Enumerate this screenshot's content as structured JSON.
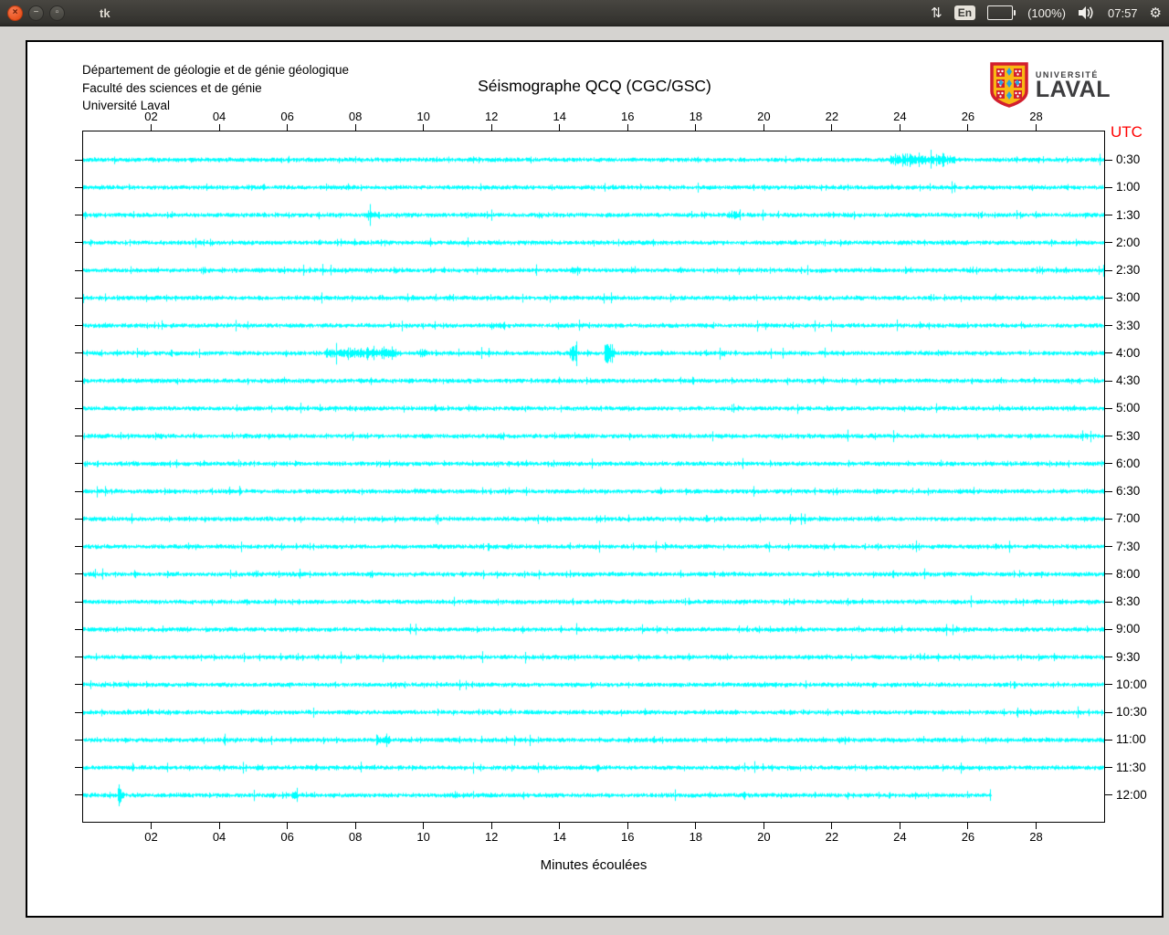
{
  "desktop": {
    "titlebar_title": "tk",
    "keyboard_layout": "En",
    "battery_label": "(100%)",
    "clock": "07:57",
    "icons": {
      "close": "×",
      "minimize": "−",
      "maximize": "▫",
      "updown_arrows": "⇅",
      "gear": "⚙"
    }
  },
  "window": {
    "header": {
      "org_lines": [
        "Département de géologie et de génie géologique",
        "Faculté des sciences et de génie",
        "Université Laval"
      ],
      "title": "Séismographe QCQ (CGC/GSC)",
      "logo": {
        "line1": "UNIVERSITÉ",
        "line2": "LAVAL"
      }
    }
  },
  "chart_data": {
    "type": "line",
    "subtype": "helicorder-seismogram",
    "title": "Séismographe QCQ (CGC/GSC)",
    "xlabel": "Minutes écoulées",
    "x_tick_labels": [
      "02",
      "04",
      "06",
      "08",
      "10",
      "12",
      "14",
      "16",
      "18",
      "20",
      "22",
      "24",
      "26",
      "28"
    ],
    "x_range_minutes": [
      0,
      30
    ],
    "right_axis_title": "UTC",
    "right_axis_title_color": "#ff0000",
    "trace_color": "#00ffff",
    "background": "#ffffff",
    "grid": false,
    "rows": [
      {
        "utc": "0:30",
        "end_minute": 30,
        "events": [
          {
            "start": 23.7,
            "end": 25.6,
            "gain": 2.2
          }
        ]
      },
      {
        "utc": "1:00",
        "end_minute": 30,
        "events": []
      },
      {
        "utc": "1:30",
        "end_minute": 30,
        "events": [
          {
            "start": 8.3,
            "end": 8.7,
            "gain": 1.9
          },
          {
            "start": 18.9,
            "end": 19.3,
            "gain": 1.7
          }
        ]
      },
      {
        "utc": "2:00",
        "end_minute": 30,
        "events": []
      },
      {
        "utc": "2:30",
        "end_minute": 30,
        "events": [
          {
            "start": 5.1,
            "end": 5.4,
            "gain": 1.5
          },
          {
            "start": 14.3,
            "end": 14.6,
            "gain": 1.5
          }
        ]
      },
      {
        "utc": "3:00",
        "end_minute": 30,
        "events": [
          {
            "start": 15.2,
            "end": 15.35,
            "gain": 1.6
          }
        ]
      },
      {
        "utc": "3:30",
        "end_minute": 30,
        "events": [
          {
            "start": 12.1,
            "end": 12.4,
            "gain": 1.7
          }
        ]
      },
      {
        "utc": "4:00",
        "end_minute": 30,
        "events": [
          {
            "start": 7.1,
            "end": 9.2,
            "gain": 2.1
          },
          {
            "start": 9.9,
            "end": 10.1,
            "gain": 1.7
          },
          {
            "start": 14.3,
            "end": 14.5,
            "gain": 4.2
          },
          {
            "start": 15.3,
            "end": 15.6,
            "gain": 4.6
          }
        ]
      },
      {
        "utc": "4:30",
        "end_minute": 30,
        "events": []
      },
      {
        "utc": "5:00",
        "end_minute": 30,
        "events": []
      },
      {
        "utc": "5:30",
        "end_minute": 30,
        "events": []
      },
      {
        "utc": "6:00",
        "end_minute": 30,
        "events": []
      },
      {
        "utc": "6:30",
        "end_minute": 30,
        "events": []
      },
      {
        "utc": "7:00",
        "end_minute": 30,
        "events": []
      },
      {
        "utc": "7:30",
        "end_minute": 30,
        "events": []
      },
      {
        "utc": "8:00",
        "end_minute": 30,
        "events": []
      },
      {
        "utc": "8:30",
        "end_minute": 30,
        "events": []
      },
      {
        "utc": "9:00",
        "end_minute": 30,
        "events": []
      },
      {
        "utc": "9:30",
        "end_minute": 30,
        "events": []
      },
      {
        "utc": "10:00",
        "end_minute": 30,
        "events": []
      },
      {
        "utc": "10:30",
        "end_minute": 30,
        "events": []
      },
      {
        "utc": "11:00",
        "end_minute": 30,
        "events": [
          {
            "start": 8.6,
            "end": 9.0,
            "gain": 1.9
          }
        ]
      },
      {
        "utc": "11:30",
        "end_minute": 30,
        "events": []
      },
      {
        "utc": "12:00",
        "end_minute": 26.7,
        "events": [
          {
            "start": 1.0,
            "end": 1.2,
            "gain": 3.2
          },
          {
            "start": 6.1,
            "end": 6.3,
            "gain": 2.2
          }
        ]
      }
    ]
  }
}
